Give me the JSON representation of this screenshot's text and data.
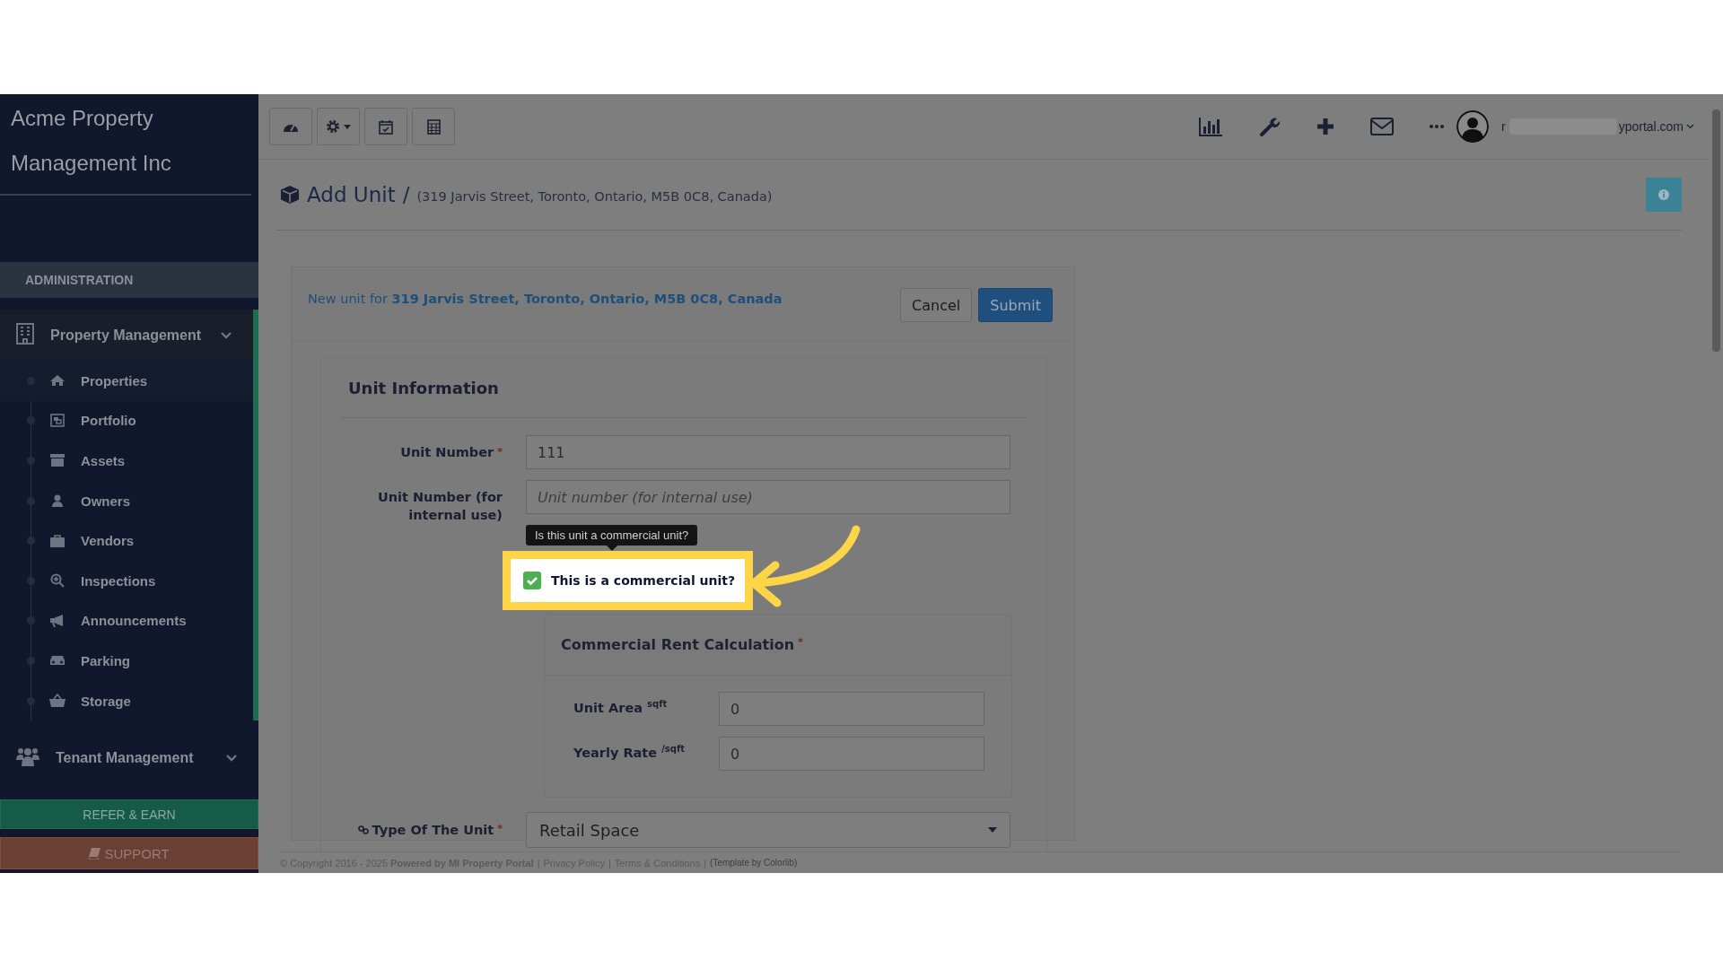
{
  "sidebar": {
    "brand": "Acme Property Management Inc",
    "section": "ADMINISTRATION",
    "groups": [
      {
        "label": "Property Management",
        "expanded": true,
        "children": [
          {
            "label": "Properties",
            "selected": true
          },
          {
            "label": "Portfolio",
            "selected": false
          },
          {
            "label": "Assets",
            "selected": false
          },
          {
            "label": "Owners",
            "selected": false
          },
          {
            "label": "Vendors",
            "selected": false
          },
          {
            "label": "Inspections",
            "selected": false
          },
          {
            "label": "Announcements",
            "selected": false
          },
          {
            "label": "Parking",
            "selected": false
          },
          {
            "label": "Storage",
            "selected": false
          }
        ]
      },
      {
        "label": "Tenant Management",
        "expanded": false
      }
    ],
    "buttons": [
      {
        "kind": "refer",
        "label": "REFER & EARN"
      },
      {
        "kind": "support",
        "label": "SUPPORT"
      }
    ]
  },
  "topbar": {
    "user": {
      "name_start": "r",
      "name_end": "yportal.com"
    }
  },
  "page": {
    "title": "Add Unit",
    "separator": "/",
    "address": "(319 Jarvis Street, Toronto, Ontario, M5B 0C8, Canada)"
  },
  "form": {
    "intro": "New unit for",
    "intro_link": "319 Jarvis Street, Toronto, Ontario, M5B 0C8, Canada",
    "cancel": "Cancel",
    "submit": "Submit",
    "section_title": "Unit Information",
    "fields": [
      {
        "label": "Unit Number",
        "required_mark": "*",
        "value": "111"
      },
      {
        "label": "Unit Number (for internal use)",
        "placeholder": "Unit number (for internal use)"
      }
    ],
    "checkbox": {
      "label": "This is a commercial unit?",
      "checked": true,
      "tooltip": "Is this unit a commercial unit?"
    },
    "commercial": {
      "title": "Commercial Rent Calculation",
      "required_mark": "*",
      "fields": [
        {
          "label": "Unit Area $^{sqft}$",
          "value": "0"
        },
        {
          "label": "Yearly Rate $^{/sqft}$",
          "value": "0"
        }
      ]
    },
    "type": {
      "label": "Type Of The Unit",
      "required_mark": "*",
      "value": "Retail Space"
    }
  },
  "footer": {
    "items": [
      {
        "kind": "text",
        "text": "© Copyright 2016 - 2025 **Powered by MI Property Portal**"
      },
      {
        "kind": "separator",
        "text": "|"
      },
      {
        "kind": "link",
        "text": "Privacy Policy"
      },
      {
        "kind": "separator",
        "text": "|"
      },
      {
        "kind": "link",
        "text": "Terms & Conditions"
      },
      {
        "kind": "separator",
        "text": "|"
      },
      {
        "kind": "credit",
        "text": "(Template by Colorlib)"
      }
    ]
  }
}
